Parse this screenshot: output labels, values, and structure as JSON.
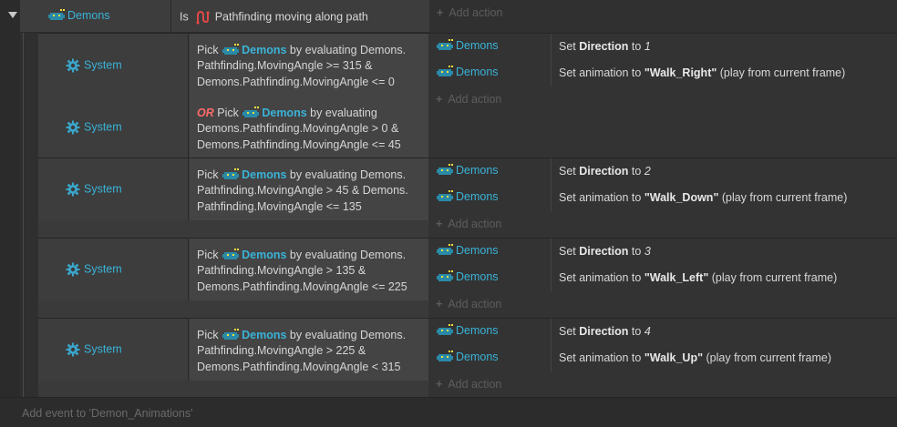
{
  "parent_event": {
    "object": "Demons",
    "condition_prefix": "Is",
    "condition_text": "Pathfinding moving along path",
    "add_action": "Add action"
  },
  "sub_events": [
    {
      "conditions": [
        {
          "object": "System",
          "or": "",
          "pick": "Pick",
          "pick_object": "Demons",
          "text": "by evaluating Demons. Pathfinding.MovingAngle >= 315 & Demons.Pathfinding.MovingAngle <= 0"
        },
        {
          "object": "System",
          "or": "OR",
          "pick": "Pick",
          "pick_object": "Demons",
          "text": "by evaluating Demons.Pathfinding.MovingAngle > 0 & Demons.Pathfinding.MovingAngle <= 45"
        }
      ],
      "actions": [
        {
          "object": "Demons",
          "prefix": "Set",
          "bold": "Direction",
          "mid": "to",
          "value": "1",
          "suffix": ""
        },
        {
          "object": "Demons",
          "prefix": "Set animation to",
          "bold": "\"Walk_Right\"",
          "mid": "",
          "value": "",
          "suffix": "(play from current frame)"
        }
      ],
      "add_action": "Add action"
    },
    {
      "conditions": [
        {
          "object": "System",
          "or": "",
          "pick": "Pick",
          "pick_object": "Demons",
          "text": "by evaluating Demons. Pathfinding.MovingAngle > 45 & Demons. Pathfinding.MovingAngle <= 135"
        }
      ],
      "actions": [
        {
          "object": "Demons",
          "prefix": "Set",
          "bold": "Direction",
          "mid": "to",
          "value": "2",
          "suffix": ""
        },
        {
          "object": "Demons",
          "prefix": "Set animation to",
          "bold": "\"Walk_Down\"",
          "mid": "",
          "value": "",
          "suffix": "(play from current frame)"
        }
      ],
      "add_action": "Add action"
    },
    {
      "conditions": [
        {
          "object": "System",
          "or": "",
          "pick": "Pick",
          "pick_object": "Demons",
          "text": "by evaluating Demons. Pathfinding.MovingAngle > 135 & Demons.Pathfinding.MovingAngle <= 225"
        }
      ],
      "actions": [
        {
          "object": "Demons",
          "prefix": "Set",
          "bold": "Direction",
          "mid": "to",
          "value": "3",
          "suffix": ""
        },
        {
          "object": "Demons",
          "prefix": "Set animation to",
          "bold": "\"Walk_Left\"",
          "mid": "",
          "value": "",
          "suffix": "(play from current frame)"
        }
      ],
      "add_action": "Add action"
    },
    {
      "conditions": [
        {
          "object": "System",
          "or": "",
          "pick": "Pick",
          "pick_object": "Demons",
          "text": "by evaluating Demons. Pathfinding.MovingAngle > 225 & Demons.Pathfinding.MovingAngle < 315"
        }
      ],
      "actions": [
        {
          "object": "Demons",
          "prefix": "Set",
          "bold": "Direction",
          "mid": "to",
          "value": "4",
          "suffix": ""
        },
        {
          "object": "Demons",
          "prefix": "Set animation to",
          "bold": "\"Walk_Up\"",
          "mid": "",
          "value": "",
          "suffix": "(play from current frame)"
        }
      ],
      "add_action": "Add action"
    }
  ],
  "footer": {
    "add_event": "Add event to 'Demon_Animations'"
  },
  "colors": {
    "object_accent": "#3ab3d8",
    "or_keyword": "#ff6a6a",
    "pathfinding_icon": "#e04848"
  },
  "icons": {
    "object": "demon-sprite-icon",
    "system": "gear-icon",
    "behavior": "pathfinding-icon"
  }
}
